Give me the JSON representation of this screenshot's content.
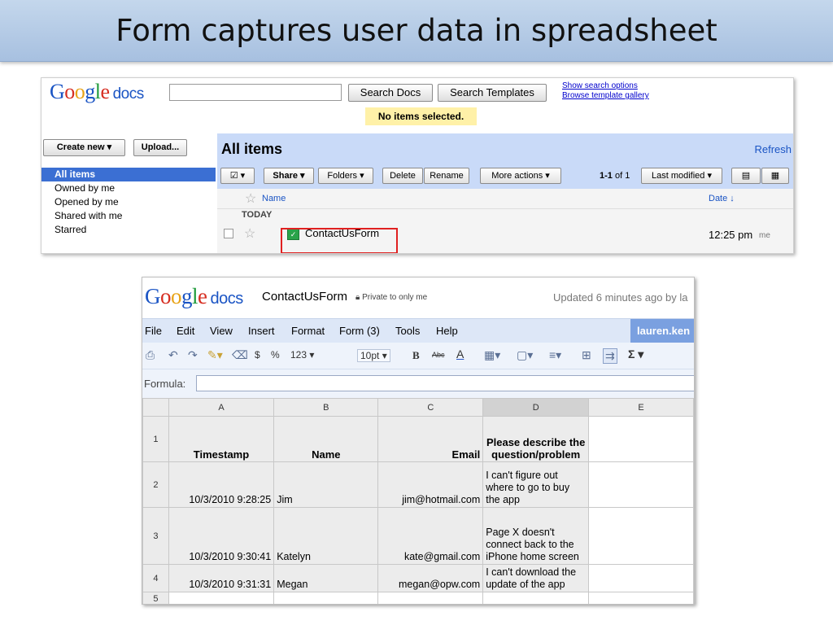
{
  "slide": {
    "title": "Form captures user data in spreadsheet"
  },
  "docs_list": {
    "logo": "Google",
    "logo_suffix": "docs",
    "search_placeholder": "",
    "search_docs_label": "Search Docs",
    "search_templates_label": "Search Templates",
    "links": [
      "Show search options",
      "Browse template gallery"
    ],
    "status_message": "No items selected.",
    "create_new_label": "Create new ▾",
    "upload_label": "Upload...",
    "nav_items": [
      "All items",
      "Owned by me",
      "Opened by me",
      "Shared with me",
      "Starred"
    ],
    "section_title": "All items",
    "refresh_label": "Refresh",
    "toolbar": {
      "select_label": "☑ ▾",
      "share_label": "Share ▾",
      "folders_label": "Folders ▾",
      "delete_label": "Delete",
      "rename_label": "Rename",
      "more_actions_label": "More actions ▾",
      "count": "1-1",
      "count_of": "of 1",
      "sort_label": "Last modified ▾"
    },
    "columns": {
      "name": "Name",
      "date": "Date ↓"
    },
    "group_label": "TODAY",
    "row": {
      "name": "ContactUsForm",
      "time": "12:25 pm",
      "owner": "me"
    }
  },
  "sheet": {
    "logo": "Google",
    "logo_suffix": "docs",
    "doc_title": "ContactUsForm",
    "privacy": "Private to only me",
    "updated": "Updated 6 minutes ago by la",
    "menus": [
      "File",
      "Edit",
      "View",
      "Insert",
      "Format",
      "Form (3)",
      "Tools",
      "Help"
    ],
    "user": "lauren.ken",
    "toolbar": {
      "currency": "$",
      "percent": "%",
      "number_format": "123 ▾",
      "font_size": "10pt ▾",
      "bold": "B",
      "strike": "Abc",
      "text_color": "A",
      "sum": "Σ ▾"
    },
    "formula_label": "Formula:",
    "formula_value": "",
    "column_letters": [
      "A",
      "B",
      "C",
      "D",
      "E"
    ],
    "headers": [
      "Timestamp",
      "Name",
      "Email",
      "Please describe the question/problem"
    ],
    "rows": [
      {
        "num": "2",
        "timestamp": "10/3/2010 9:28:25",
        "name": "Jim",
        "email": "jim@hotmail.com",
        "problem": "I can't figure out where to go to buy the app"
      },
      {
        "num": "3",
        "timestamp": "10/3/2010 9:30:41",
        "name": "Katelyn",
        "email": "kate@gmail.com",
        "problem": "Page X doesn't connect back to the iPhone home screen"
      },
      {
        "num": "4",
        "timestamp": "10/3/2010 9:31:31",
        "name": "Megan",
        "email": "megan@opw.com",
        "problem": "I can't download the update of the app"
      }
    ],
    "header_row_num": "1",
    "empty_row_num": "5"
  }
}
